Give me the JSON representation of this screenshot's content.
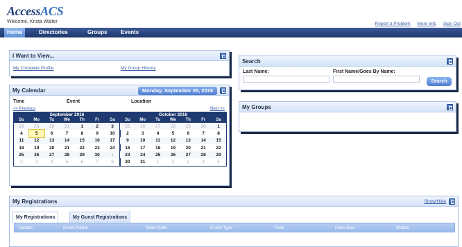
{
  "app": {
    "logo_part1": "Access",
    "logo_part2": "ACS",
    "welcome": "Welcome, Krista Walter"
  },
  "top_links": [
    "Report a Problem",
    "More Info",
    "Sign Out"
  ],
  "nav": [
    "Home",
    "Directories",
    "Groups",
    "Events"
  ],
  "i_want_to_view": {
    "title": "I Want to View...",
    "links": [
      "My Complete Profile",
      "My Group History"
    ]
  },
  "calendar": {
    "title": "My Calendar",
    "date_button": "Monday, September 05, 2016",
    "columns": [
      "Time",
      "Event",
      "Location"
    ],
    "prev_link": "<< Previous",
    "next_link": "Next >>",
    "day_names": [
      "Su",
      "Mo",
      "Tu",
      "We",
      "Th",
      "Fr",
      "Sa"
    ],
    "months": [
      {
        "name": "September 2016",
        "weeks": [
          [
            "28",
            "29",
            "30",
            "31",
            "1",
            "2",
            "3"
          ],
          [
            "4",
            "5",
            "6",
            "7",
            "8",
            "9",
            "10"
          ],
          [
            "11",
            "12",
            "13",
            "14",
            "15",
            "16",
            "17"
          ],
          [
            "18",
            "19",
            "20",
            "21",
            "22",
            "23",
            "24"
          ],
          [
            "25",
            "26",
            "27",
            "28",
            "29",
            "30",
            "1"
          ],
          [
            "2",
            "3",
            "4",
            "5",
            "6",
            "7",
            "8"
          ]
        ]
      },
      {
        "name": "October 2016",
        "weeks": [
          [
            "25",
            "26",
            "27",
            "28",
            "29",
            "30",
            "1"
          ],
          [
            "2",
            "3",
            "4",
            "5",
            "6",
            "7",
            "8"
          ],
          [
            "9",
            "10",
            "11",
            "12",
            "13",
            "14",
            "15"
          ],
          [
            "16",
            "17",
            "18",
            "19",
            "20",
            "21",
            "22"
          ],
          [
            "23",
            "24",
            "25",
            "26",
            "27",
            "28",
            "29"
          ],
          [
            "30",
            "31",
            "1",
            "2",
            "3",
            "4",
            "5"
          ]
        ]
      }
    ],
    "today": "5"
  },
  "search": {
    "title": "Search",
    "last_name_label": "Last Name:",
    "first_name_label": "First Name/Goes By Name:",
    "button": "Search"
  },
  "groups": {
    "title": "My Groups"
  },
  "registrations": {
    "title": "My Registrations",
    "show_hide": "Show/Hide",
    "tabs": [
      "My Registrations",
      "My Guest Registrations"
    ],
    "columns": [
      "Details",
      "Event Name",
      "Start Date",
      "Event Type",
      "Role",
      "Fees Due",
      "Status"
    ]
  },
  "colors": {
    "nav": "#1f3a70",
    "accent": "#4f7fd0",
    "panel_border": "#a9bfe2",
    "link": "#3a5ea7"
  }
}
